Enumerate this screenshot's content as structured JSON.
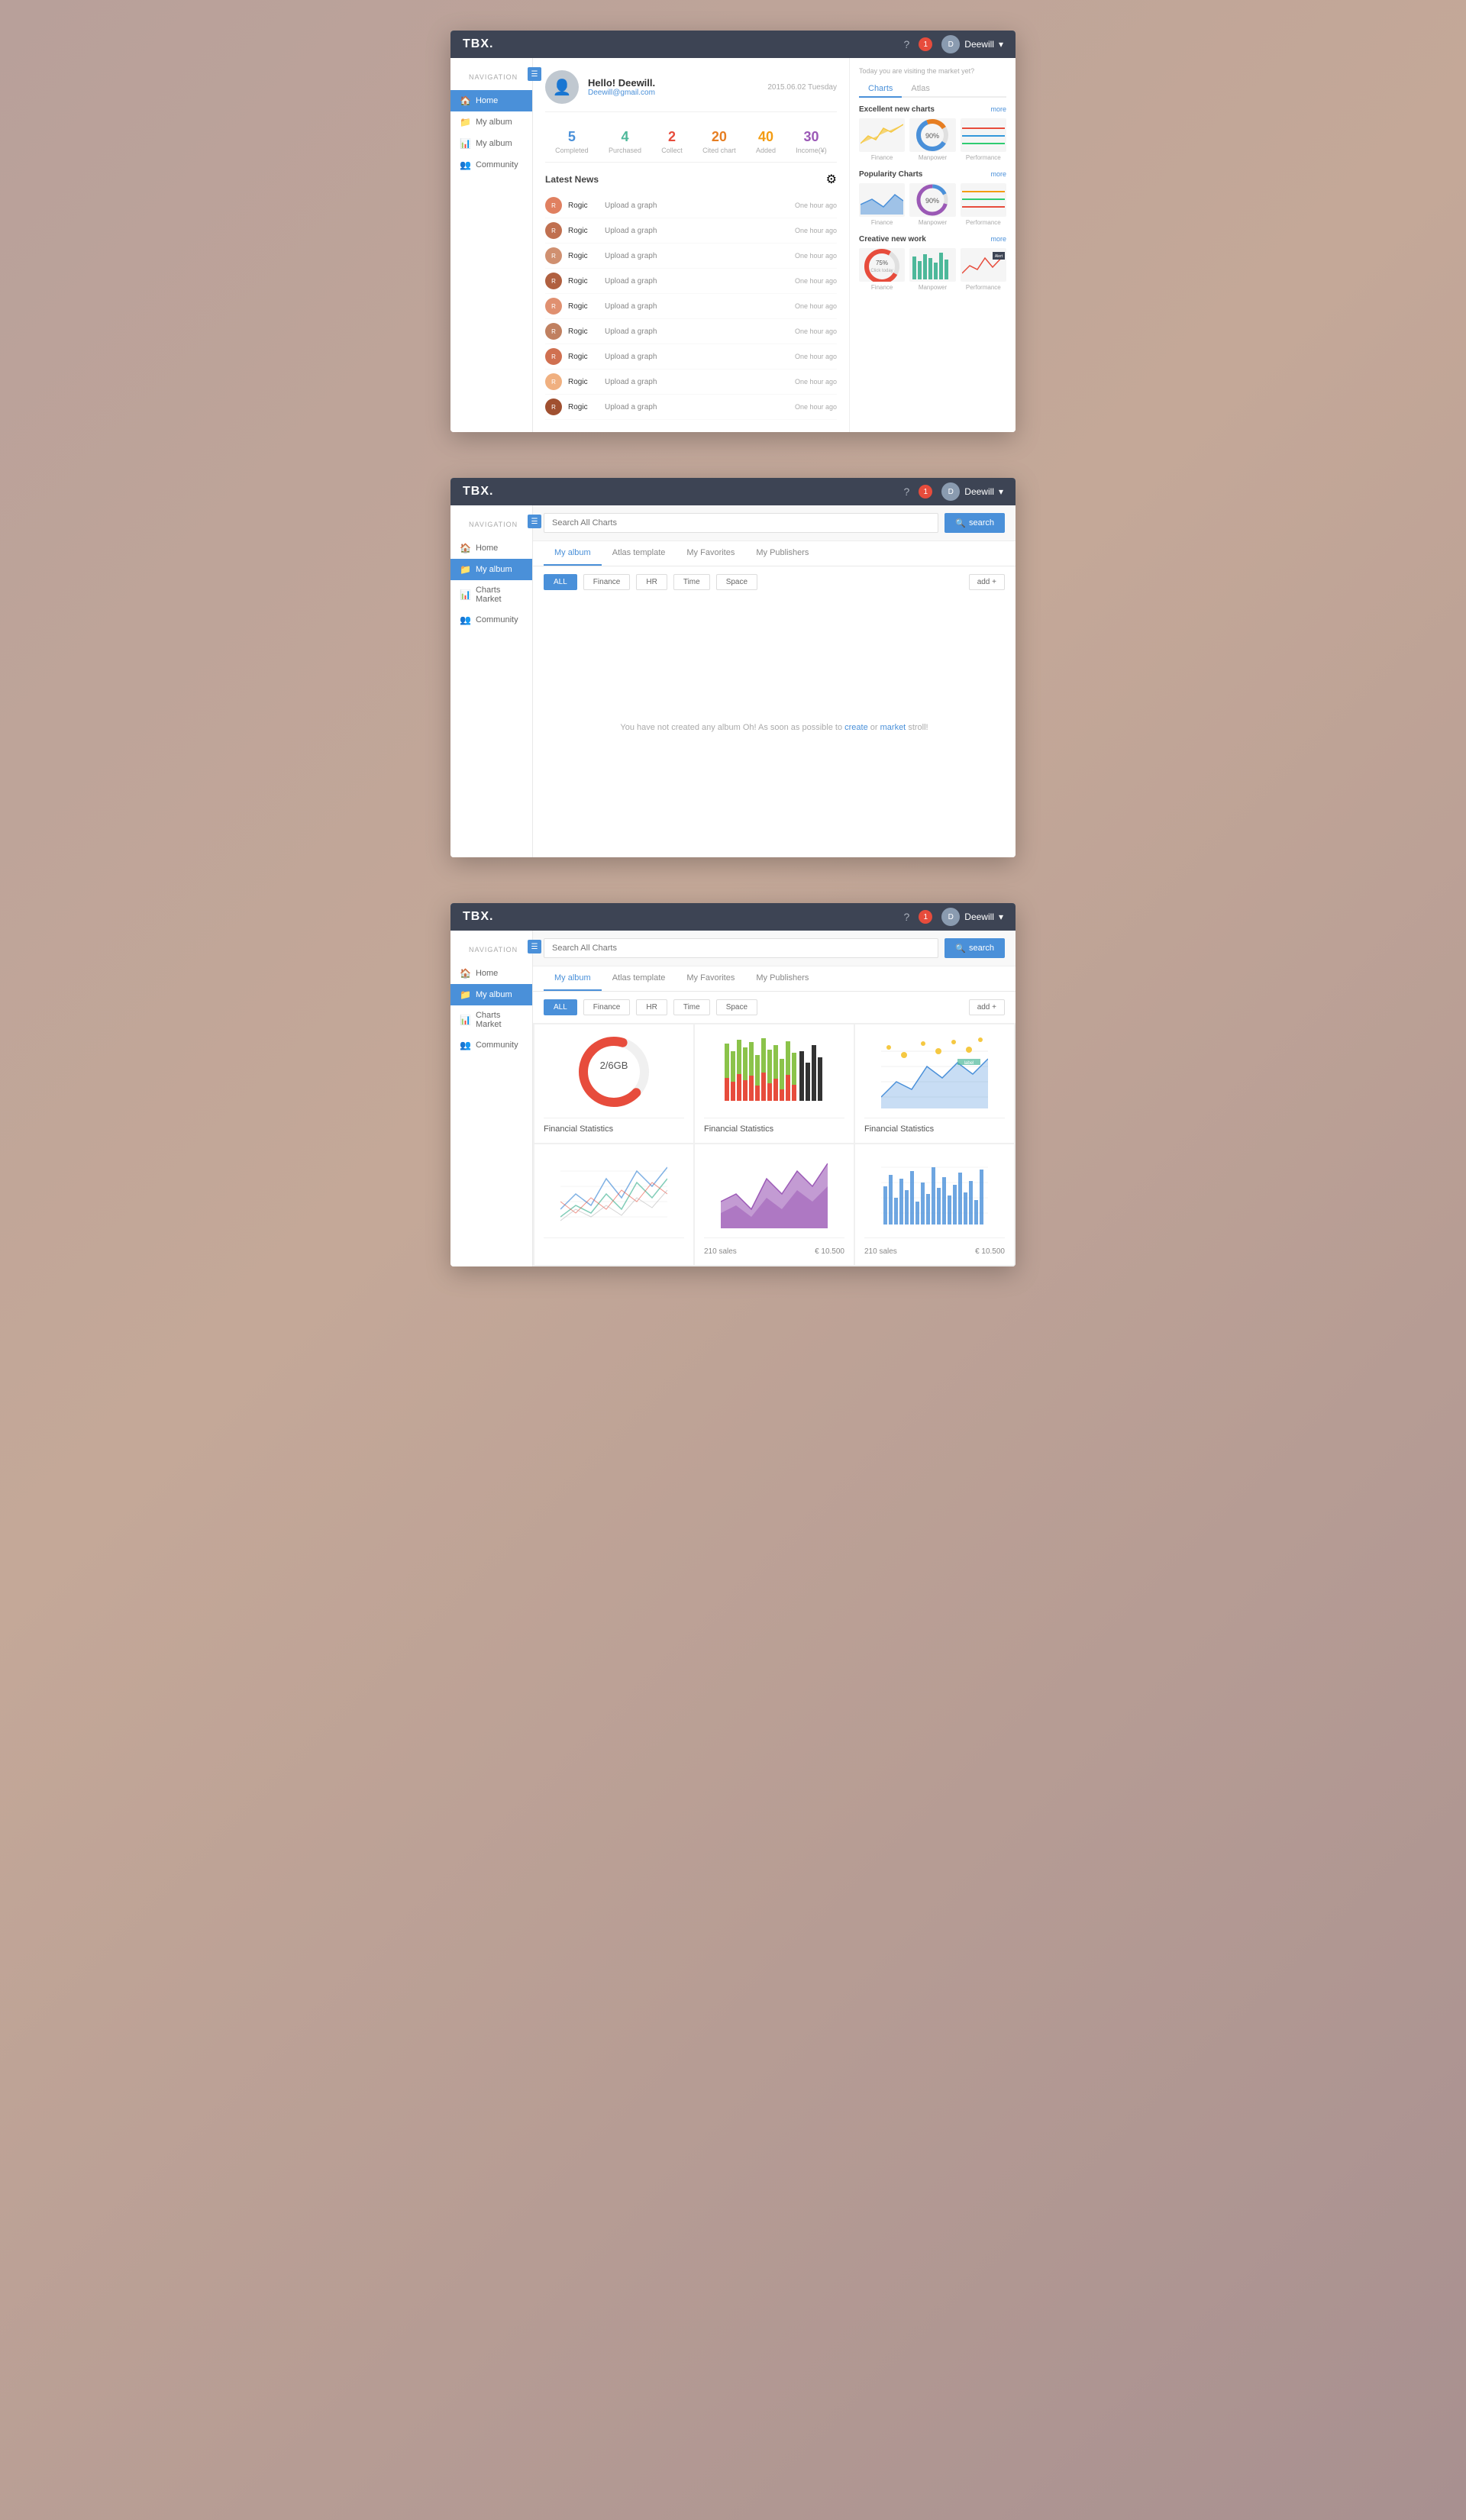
{
  "app": {
    "logo": "TBX.",
    "topbar_icons": [
      "?",
      "🔔"
    ],
    "user": "Deewill",
    "notif_count": "1"
  },
  "sidebar": {
    "nav_label": "Navigation",
    "items": [
      {
        "label": "Home",
        "icon": "🏠",
        "active": false
      },
      {
        "label": "My album",
        "icon": "📁",
        "active": false
      },
      {
        "label": "Charts Market",
        "icon": "📊",
        "active": false
      },
      {
        "label": "Community",
        "icon": "👥",
        "active": false
      }
    ]
  },
  "window1": {
    "active_nav": "Home",
    "user": {
      "name": "Hello! Deewill.",
      "email": "Deewill@gmail.com",
      "date": "2015.06.02 Tuesday"
    },
    "stats": [
      {
        "value": "5",
        "label": "Completed",
        "color": "blue"
      },
      {
        "value": "4",
        "label": "Purchased",
        "color": "green"
      },
      {
        "value": "2",
        "label": "Collect",
        "color": "red"
      },
      {
        "value": "20",
        "label": "Cited chart",
        "color": "orange"
      },
      {
        "value": "40",
        "label": "Added",
        "color": "yellow"
      },
      {
        "value": "30",
        "label": "Income(¥)",
        "color": "purple"
      }
    ],
    "latest_news": {
      "title": "Latest News",
      "items": [
        {
          "name": "Rogic",
          "action": "Upload a graph",
          "time": "One hour ago"
        },
        {
          "name": "Rogic",
          "action": "Upload a graph",
          "time": "One hour ago"
        },
        {
          "name": "Rogic",
          "action": "Upload a graph",
          "time": "One hour ago"
        },
        {
          "name": "Rogic",
          "action": "Upload a graph",
          "time": "One hour ago"
        },
        {
          "name": "Rogic",
          "action": "Upload a graph",
          "time": "One hour ago"
        },
        {
          "name": "Rogic",
          "action": "Upload a graph",
          "time": "One hour ago"
        },
        {
          "name": "Rogic",
          "action": "Upload a graph",
          "time": "One hour ago"
        },
        {
          "name": "Rogic",
          "action": "Upload a graph",
          "time": "One hour ago"
        },
        {
          "name": "Rogic",
          "action": "Upload a graph",
          "time": "One hour ago"
        }
      ]
    },
    "right_panel": {
      "header": "Today you are visiting the market yet?",
      "tabs": [
        "Charts",
        "Atlas"
      ],
      "active_tab": "Charts",
      "sections": [
        {
          "title": "Excellent new charts",
          "more": "more",
          "charts": [
            {
              "label": "Finance",
              "type": "finance"
            },
            {
              "label": "Manpower",
              "type": "donut"
            },
            {
              "label": "Performance",
              "type": "lines"
            }
          ]
        },
        {
          "title": "Popularity Charts",
          "more": "more",
          "charts": [
            {
              "label": "Finance",
              "type": "area_small"
            },
            {
              "label": "Manpower",
              "type": "donut2"
            },
            {
              "label": "Performance",
              "type": "lines2"
            }
          ]
        },
        {
          "title": "Creative new work",
          "more": "more",
          "charts": [
            {
              "label": "Finance",
              "type": "gauge"
            },
            {
              "label": "Manpower",
              "type": "bars_small"
            },
            {
              "label": "Performance",
              "type": "line_small"
            }
          ]
        }
      ]
    }
  },
  "window2": {
    "active_nav": "My album",
    "search_placeholder": "Search All Charts",
    "search_label": "search",
    "tabs": [
      "My album",
      "Atlas template",
      "My Favorites",
      "My Publishers"
    ],
    "active_tab": "My album",
    "filters": [
      "ALL",
      "Finance",
      "HR",
      "Time",
      "Space"
    ],
    "active_filter": "ALL",
    "add_label": "add +",
    "empty_message": "You have not created any album Oh! As soon as possible to",
    "empty_create": "create",
    "empty_or": "or",
    "empty_market": "market",
    "empty_stroll": "stroll!"
  },
  "window3": {
    "active_nav": "My album",
    "search_placeholder": "Search All Charts",
    "search_label": "search",
    "tabs": [
      "My album",
      "Atlas template",
      "My Favorites",
      "My Publishers"
    ],
    "active_tab": "My album",
    "filters": [
      "ALL",
      "Finance",
      "HR",
      "Time",
      "Space"
    ],
    "active_filter": "ALL",
    "add_label": "add +",
    "cards": [
      {
        "title": "Financial Statistics",
        "type": "donut_lg",
        "meta": {
          "left": "",
          "right": ""
        }
      },
      {
        "title": "Financial Statistics",
        "type": "bar_grouped",
        "meta": {
          "left": "",
          "right": ""
        }
      },
      {
        "title": "Financial Statistics",
        "type": "area_scatter",
        "meta": {
          "left": "",
          "right": ""
        }
      },
      {
        "title": "",
        "type": "line_multi",
        "meta": {
          "left": "",
          "right": ""
        }
      },
      {
        "title": "",
        "type": "area_purple",
        "meta": {
          "left": "210 sales",
          "right": "€ 10.500"
        }
      },
      {
        "title": "",
        "type": "bar_blue",
        "meta": {
          "left": "210 sales",
          "right": "€ 10.500"
        }
      }
    ]
  }
}
